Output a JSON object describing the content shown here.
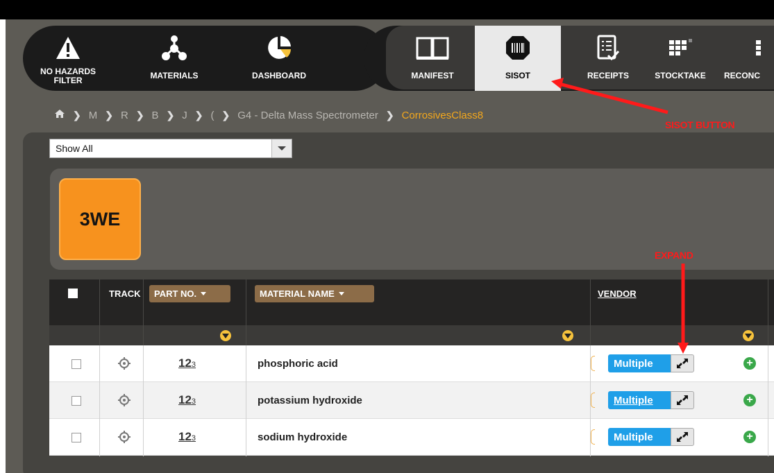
{
  "nav": {
    "left": [
      {
        "label": "NO HAZARDS FILTER",
        "icon": "warning-icon"
      },
      {
        "label": "MATERIALS",
        "icon": "molecule-icon"
      },
      {
        "label": "DASHBOARD",
        "icon": "pie-chart-icon"
      }
    ],
    "right": [
      {
        "label": "MANIFEST",
        "icon": "book-icon"
      },
      {
        "label": "SISOT",
        "icon": "barcode-icon"
      },
      {
        "label": "RECEIPTS",
        "icon": "checklist-icon"
      },
      {
        "label": "STOCKTAKE",
        "icon": "grid-icon"
      },
      {
        "label": "RECONC",
        "icon": "grid-icon"
      }
    ]
  },
  "breadcrumb": {
    "items": [
      "M",
      "R",
      "B",
      "J",
      "("
    ],
    "location": "G4 - Delta Mass Spectrometer",
    "current": "CorrosivesClass8"
  },
  "annotations": {
    "sisot": "SISOT BUTTON",
    "expand": "EXPAND"
  },
  "filter_select": {
    "value": "Show All"
  },
  "group_tile": {
    "label": "3WE",
    "color": "#f7921e"
  },
  "table": {
    "headers": {
      "track": "TRACK",
      "part_no": "PART NO.",
      "material_name": "MATERIAL NAME",
      "vendor": "VENDOR"
    },
    "part_no_icon_text": {
      "main": "12",
      "sup": "3"
    },
    "rows": [
      {
        "material": "phosphoric acid",
        "vendor": "Multiple"
      },
      {
        "material": "potassium hydroxide",
        "vendor": "Multiple"
      },
      {
        "material": "sodium hydroxide",
        "vendor": "Multiple"
      }
    ]
  },
  "colors": {
    "accent_orange": "#f7921e",
    "breadcrumb_current": "#f4a81c",
    "vendor_blue": "#1f9fe8",
    "annotation_red": "#ff1a1a",
    "add_green": "#3aa84a"
  }
}
